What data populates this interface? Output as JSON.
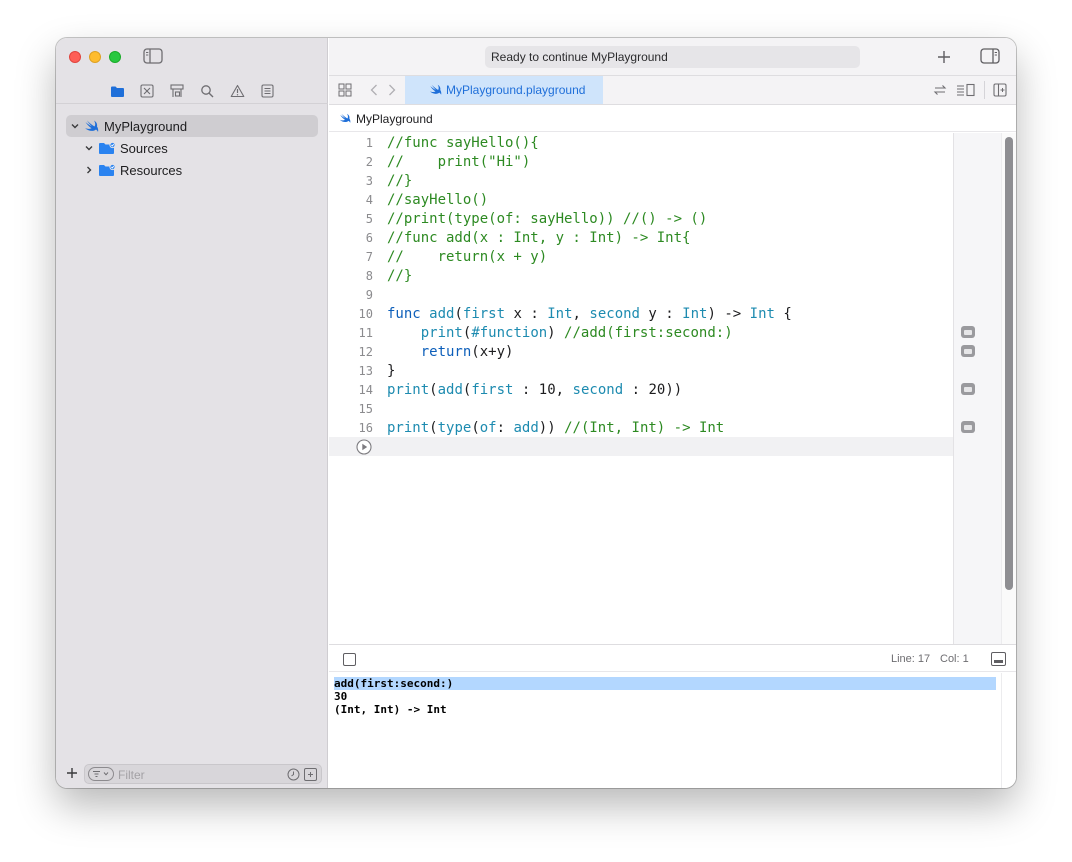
{
  "toolbar": {
    "status": "Ready to continue MyPlayground"
  },
  "tab": {
    "title": "MyPlayground.playground"
  },
  "jumpbar": {
    "path": "MyPlayground"
  },
  "sidebar": {
    "items": [
      {
        "label": "MyPlayground",
        "icon": "swift-icon"
      },
      {
        "label": "Sources",
        "icon": "folder-icon"
      },
      {
        "label": "Resources",
        "icon": "folder-icon"
      }
    ],
    "filter_placeholder": "Filter"
  },
  "editor": {
    "lines": [
      {
        "num": "1",
        "text": "//func sayHello(){",
        "kind": "comment"
      },
      {
        "num": "2",
        "text": "//    print(\"Hi\")",
        "kind": "comment"
      },
      {
        "num": "3",
        "text": "//}",
        "kind": "comment"
      },
      {
        "num": "4",
        "text": "//sayHello()",
        "kind": "comment"
      },
      {
        "num": "5",
        "text": "//print(type(of: sayHello)) //() -> ()",
        "kind": "comment"
      },
      {
        "num": "6",
        "text": "//func add(x : Int, y : Int) -> Int{",
        "kind": "comment"
      },
      {
        "num": "7",
        "text": "//    return(x + y)",
        "kind": "comment"
      },
      {
        "num": "8",
        "text": "//}",
        "kind": "comment"
      },
      {
        "num": "9",
        "text": "",
        "kind": "plain"
      },
      {
        "num": "10",
        "text": "func add(first x : Int, second y : Int) -> Int {",
        "kind": "code"
      },
      {
        "num": "11",
        "text": "    print(#function) //add(first:second:)",
        "kind": "code"
      },
      {
        "num": "12",
        "text": "    return(x+y)",
        "kind": "code"
      },
      {
        "num": "13",
        "text": "}",
        "kind": "code"
      },
      {
        "num": "14",
        "text": "print(add(first : 10, second : 20))",
        "kind": "code"
      },
      {
        "num": "15",
        "text": "",
        "kind": "plain"
      },
      {
        "num": "16",
        "text": "print(type(of: add)) //(Int, Int) -> Int",
        "kind": "code"
      }
    ]
  },
  "debug": {
    "line_label": "Line: 17",
    "col_label": "Col: 1"
  },
  "console": {
    "lines": [
      "add(first:second:)",
      "30",
      "(Int, Int) -> Int"
    ]
  },
  "colors": {
    "accent": "#1f6fd9",
    "comment": "#2d8a22",
    "keyword": "#0d5fba",
    "function": "#1d8bb0",
    "selection": "#b3d7ff"
  }
}
